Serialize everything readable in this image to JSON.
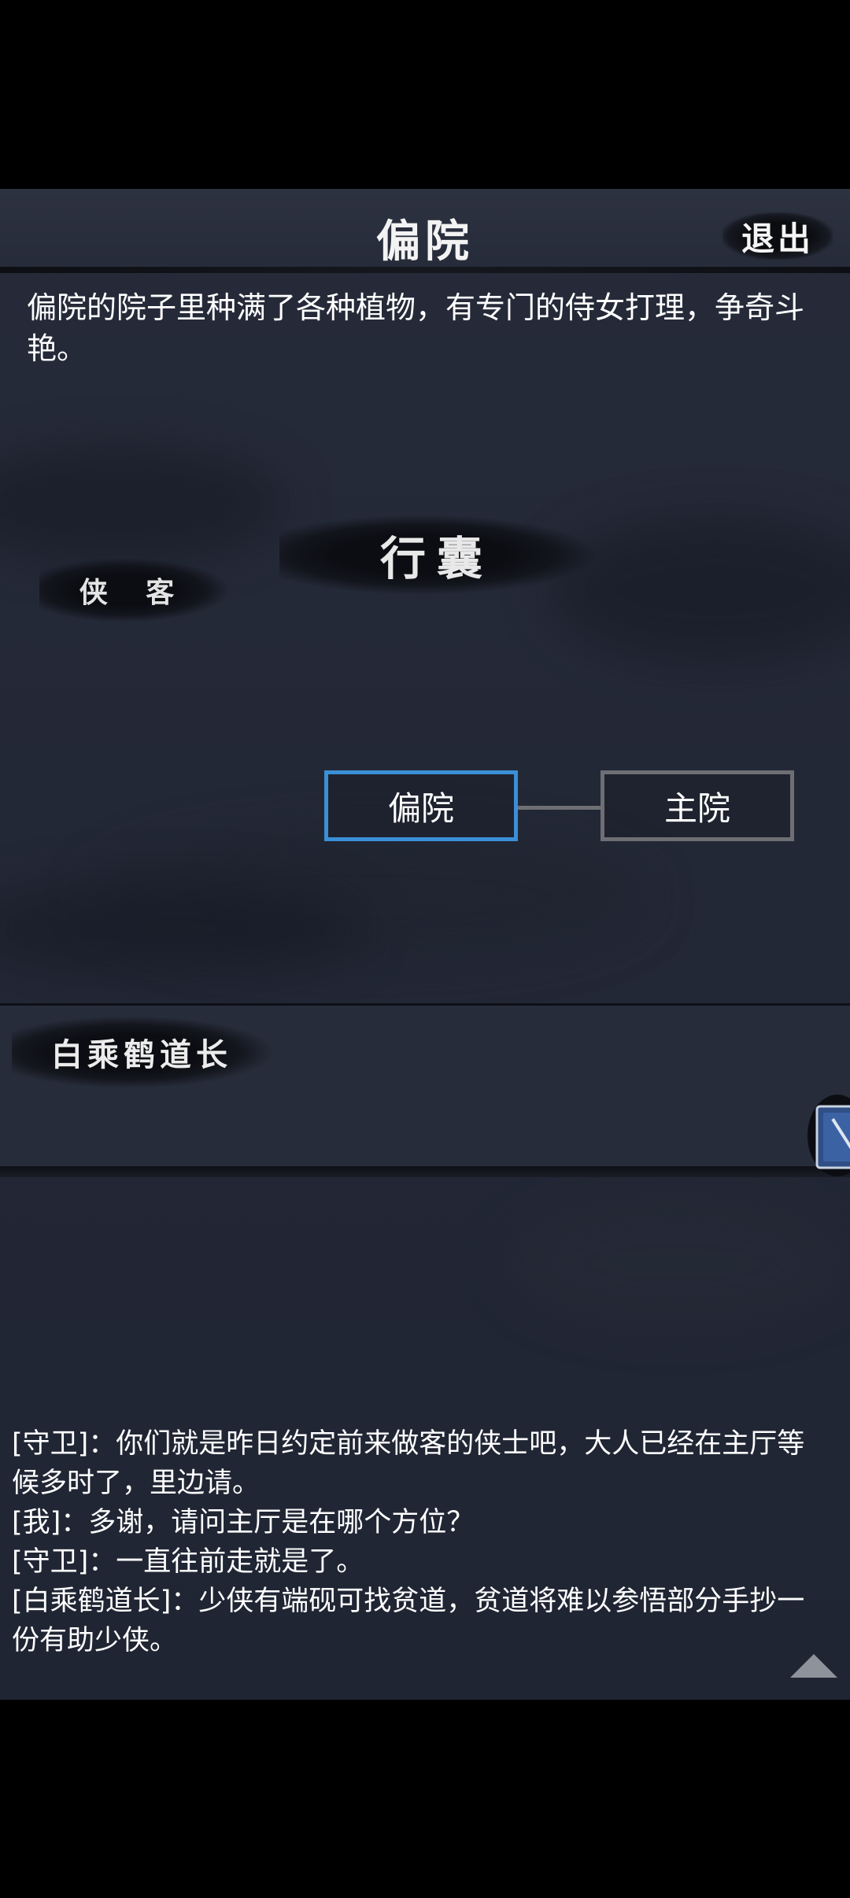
{
  "header": {
    "title": "偏院",
    "exit_label": "退出"
  },
  "location": {
    "description": "偏院的院子里种满了各种植物，有专门的侍女打理，争奇斗艳。"
  },
  "tabs": {
    "bag": "行囊",
    "hero": "侠 客"
  },
  "map": {
    "nodes": [
      {
        "label": "偏院",
        "current": true
      },
      {
        "label": "主院",
        "current": false
      }
    ]
  },
  "npc": {
    "name": "白乘鹤道长"
  },
  "dialog_log": [
    "[守卫]：你们就是昨日约定前来做客的侠士吧，大人已经在主厅等候多时了，里边请。",
    "[我]：多谢，请问主厅是在哪个方位？",
    "[守卫]：一直往前走就是了。",
    "[白乘鹤道长]：少侠有端砚可找贫道，贫道将难以参悟部分手抄一份有助少侠。"
  ],
  "colors": {
    "current_node_border": "#3a8fd6",
    "node_border": "#6d6f74",
    "background": "#232836"
  },
  "icons": {
    "book": "book-icon",
    "scroll_up": "triangle-up-icon"
  }
}
